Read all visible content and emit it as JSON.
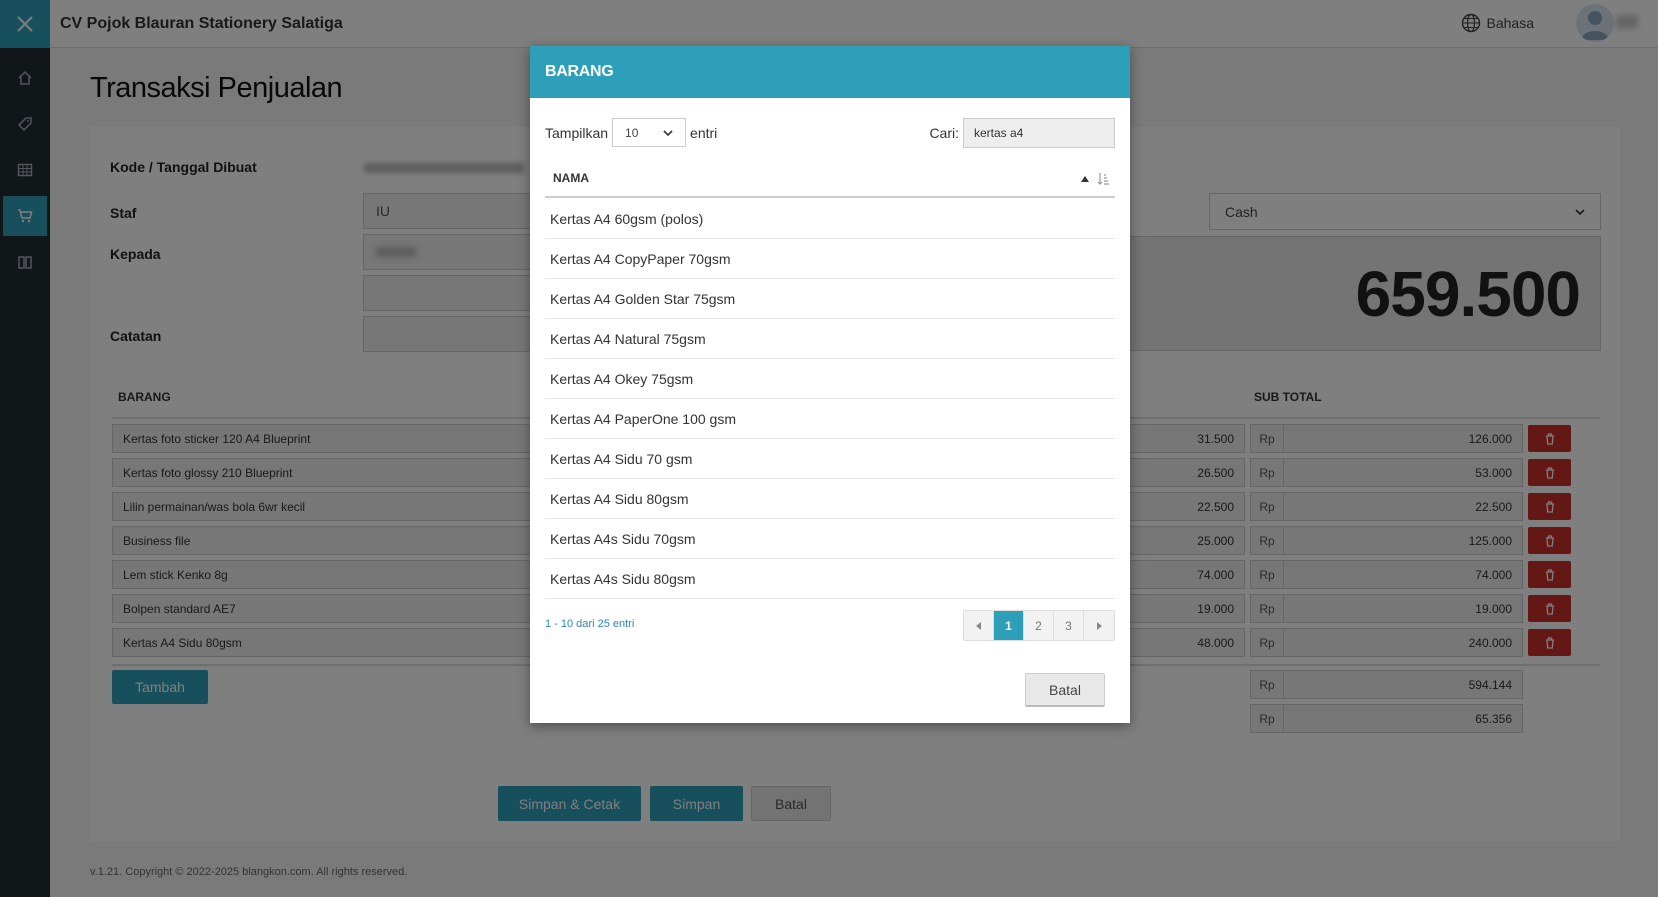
{
  "app": {
    "title": "CV Pojok Blauran Stationery Salatiga",
    "language_label": "Bahasa"
  },
  "sidebar": {
    "items": [
      {
        "icon": "home-icon"
      },
      {
        "icon": "tag-icon"
      },
      {
        "icon": "table-icon"
      },
      {
        "icon": "cart-icon",
        "active": true
      },
      {
        "icon": "book-icon"
      }
    ]
  },
  "page": {
    "title": "Transaksi Penjualan",
    "labels": {
      "code_date": "Kode / Tanggal Dibuat",
      "staff": "Staf",
      "to": "Kepada",
      "notes": "Catatan"
    },
    "staff_value": "IU",
    "payment_method": "Cash",
    "total": "659.500",
    "table_headers": {
      "item": "BARANG",
      "subtotal": "SUB TOTAL"
    },
    "rows": [
      {
        "name": "Kertas foto sticker 120 A4 Blueprint",
        "price": "31.500",
        "currency": "Rp",
        "subtotal": "126.000"
      },
      {
        "name": "Kertas foto glossy 210 Blueprint",
        "price": "26.500",
        "currency": "Rp",
        "subtotal": "53.000"
      },
      {
        "name": "Lilin permainan/was bola 6wr kecil",
        "price": "22.500",
        "currency": "Rp",
        "subtotal": "22.500"
      },
      {
        "name": "Business file",
        "price": "25.000",
        "currency": "Rp",
        "subtotal": "125.000"
      },
      {
        "name": "Lem stick Kenko 8g",
        "price": "74.000",
        "currency": "Rp",
        "subtotal": "74.000"
      },
      {
        "name": "Bolpen standard AE7",
        "price": "19.000",
        "currency": "Rp",
        "subtotal": "19.000"
      },
      {
        "name": "Kertas A4 Sidu 80gsm",
        "price": "48.000",
        "currency": "Rp",
        "subtotal": "240.000"
      }
    ],
    "summary": [
      {
        "currency": "Rp",
        "value": "594.144"
      },
      {
        "currency": "Rp",
        "value": "65.356"
      }
    ],
    "add_button": "Tambah",
    "save_print_button": "Simpan & Cetak",
    "save_button": "Simpan",
    "cancel_button": "Batal",
    "footer": "v.1.21. Copyright © 2022-2025 blangkon.com. All rights reserved."
  },
  "modal": {
    "title": "BARANG",
    "show_label": "Tampilkan",
    "show_value": "10",
    "entries_label": "entri",
    "search_label": "Cari:",
    "search_value": "kertas a4",
    "column_header": "NAMA",
    "items": [
      "Kertas A4 60gsm (polos)",
      "Kertas A4 CopyPaper 70gsm",
      "Kertas A4 Golden Star 75gsm",
      "Kertas A4 Natural 75gsm",
      "Kertas A4 Okey 75gsm",
      "Kertas A4 PaperOne 100 gsm",
      "Kertas A4 Sidu 70 gsm",
      "Kertas A4 Sidu 80gsm",
      "Kertas A4s Sidu 70gsm",
      "Kertas A4s Sidu 80gsm"
    ],
    "info": "1 - 10 dari 25 entri",
    "pages": [
      "1",
      "2",
      "3"
    ],
    "current_page": "1",
    "cancel_button": "Batal"
  },
  "colors": {
    "accent": "#2e9fb8",
    "sidebar": "#222d32",
    "danger": "#c9302c"
  }
}
